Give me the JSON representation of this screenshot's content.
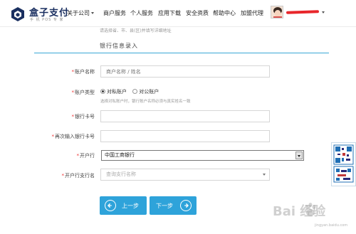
{
  "brand": {
    "name": "盒子支付",
    "tagline": "手 机 POS 专 家"
  },
  "nav": {
    "items": [
      {
        "label": "关于公司",
        "dropdown": true
      },
      {
        "label": "商户服务"
      },
      {
        "label": "个人服务"
      },
      {
        "label": "应用下载"
      },
      {
        "label": "安全资质"
      },
      {
        "label": "帮助中心"
      },
      {
        "label": "加盟代理"
      }
    ]
  },
  "form": {
    "top_hint": "请选择省、市、县(区)并填写详细地址",
    "section_title": "银行信息录入",
    "required_mark": "*",
    "account_name": {
      "label": "账户名称",
      "placeholder": "商户名称 / 姓名",
      "value": ""
    },
    "account_type": {
      "label": "账户类型",
      "options": [
        "对私账户",
        "对公账户"
      ],
      "selected": "对私账户",
      "note": "选择对私账户时，银行账户名称必须与真实姓名一致"
    },
    "card_number": {
      "label": "银行卡号",
      "value": ""
    },
    "card_number_repeat": {
      "label": "再次输入银行卡号",
      "value": ""
    },
    "bank": {
      "label": "开户行",
      "value": "中国工商银行"
    },
    "branch": {
      "label": "开户行支行名",
      "placeholder": "查询支行名称"
    },
    "prev_button": "上一步",
    "next_button": "下一步"
  },
  "watermark": {
    "text": "Bai 经验",
    "sub": "jingyan.baidu.com"
  },
  "colors": {
    "accent": "#2ea3da",
    "divider": "#3aa7d6",
    "brand": "#1a2f60",
    "required": "#e33333"
  },
  "icons": [
    "logo-mark-icon",
    "dropdown-caret-icon",
    "arrow-left-circle-icon",
    "arrow-right-circle-icon",
    "qr-code-icon",
    "baidu-paw-icon"
  ]
}
